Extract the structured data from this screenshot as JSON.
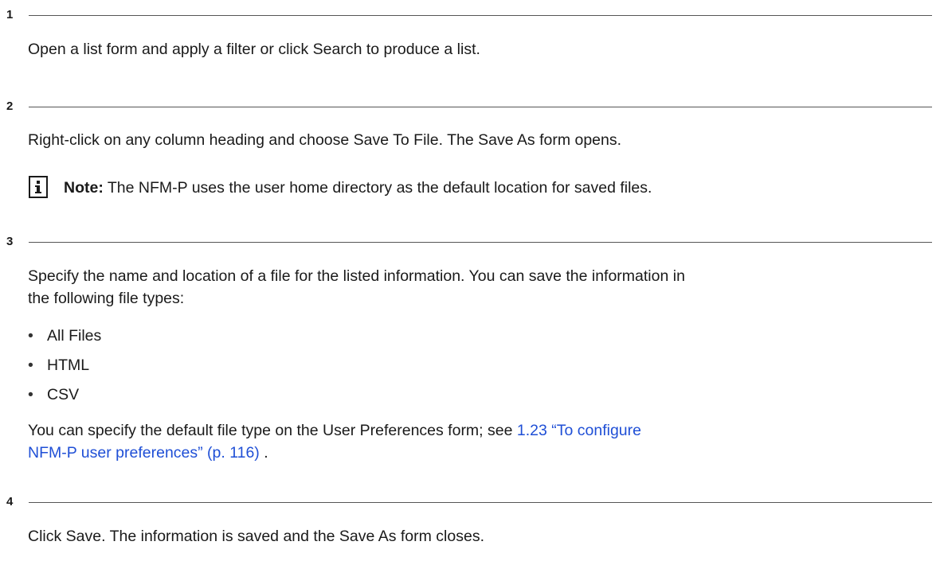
{
  "steps": [
    {
      "number": "1",
      "text": "Open a list form and apply a filter or click Search to produce a list."
    },
    {
      "number": "2",
      "text": "Right-click on any column heading and choose Save To File. The Save As form opens.",
      "note": {
        "icon": "info-icon",
        "label": "Note:",
        "text": " The NFM-P uses the user home directory as the default location for saved files."
      }
    },
    {
      "number": "3",
      "text_line1": "Specify the name and location of a file for the listed information. You can save the information in",
      "text_line2": "the following file types:",
      "bullets": [
        "All Files",
        "HTML",
        "CSV"
      ],
      "bullet_glyph": "•",
      "after_text": "You can specify the default file type on the User Preferences form; see ",
      "link_line1": "1.23 “To configure",
      "link_line2": "NFM-P user preferences” (p. 116)",
      "after_link": " ."
    },
    {
      "number": "4",
      "text": "Click Save. The information is saved and the Save As form closes."
    }
  ],
  "colors": {
    "text": "#1a1a1a",
    "link": "#1f4fd6",
    "rule": "#555555"
  }
}
